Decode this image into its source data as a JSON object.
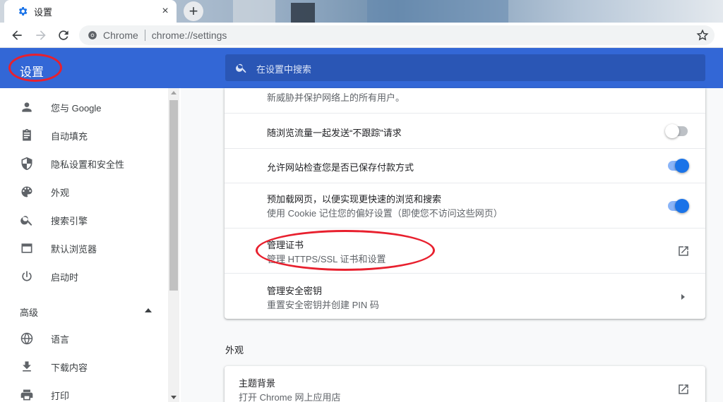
{
  "tab": {
    "title": "设置",
    "icon": "gear-icon",
    "close": "×"
  },
  "newtab": {
    "label": "+"
  },
  "toolbar": {
    "site_name": "Chrome",
    "url": "chrome://settings"
  },
  "header": {
    "title": "设置",
    "search_placeholder": "在设置中搜索"
  },
  "sidebar": {
    "items": [
      {
        "label": "您与 Google",
        "icon": "person-icon"
      },
      {
        "label": "自动填充",
        "icon": "clipboard-icon"
      },
      {
        "label": "隐私设置和安全性",
        "icon": "shield-icon"
      },
      {
        "label": "外观",
        "icon": "palette-icon"
      },
      {
        "label": "搜索引擎",
        "icon": "search-icon"
      },
      {
        "label": "默认浏览器",
        "icon": "browser-icon"
      },
      {
        "label": "启动时",
        "icon": "power-icon"
      }
    ],
    "advanced": "高级",
    "advanced_items": [
      {
        "label": "语言",
        "icon": "globe-icon"
      },
      {
        "label": "下载内容",
        "icon": "download-icon"
      },
      {
        "label": "打印",
        "icon": "print-icon"
      }
    ]
  },
  "privacy": {
    "top_text": "新威胁并保护网络上的所有用户。",
    "rows": [
      {
        "title": "随浏览流量一起发送“不跟踪”请求",
        "control": "toggle",
        "on": false
      },
      {
        "title": "允许网站检查您是否已保存付款方式",
        "control": "toggle",
        "on": true
      },
      {
        "title": "预加载网页，以便实现更快速的浏览和搜索",
        "subtitle": "使用 Cookie 记住您的偏好设置（即使您不访问这些网页）",
        "control": "toggle",
        "on": true
      },
      {
        "title": "管理证书",
        "subtitle": "管理 HTTPS/SSL 证书和设置",
        "control": "external-link"
      },
      {
        "title": "管理安全密钥",
        "subtitle": "重置安全密钥并创建 PIN 码",
        "control": "chevron"
      }
    ]
  },
  "appearance": {
    "section_title": "外观",
    "theme_title": "主题背景",
    "theme_subtitle": "打开 Chrome 网上应用店"
  },
  "colors": {
    "header": "#3367d6",
    "toggle_on": "#1a73e8",
    "highlight": "#e8202e"
  }
}
